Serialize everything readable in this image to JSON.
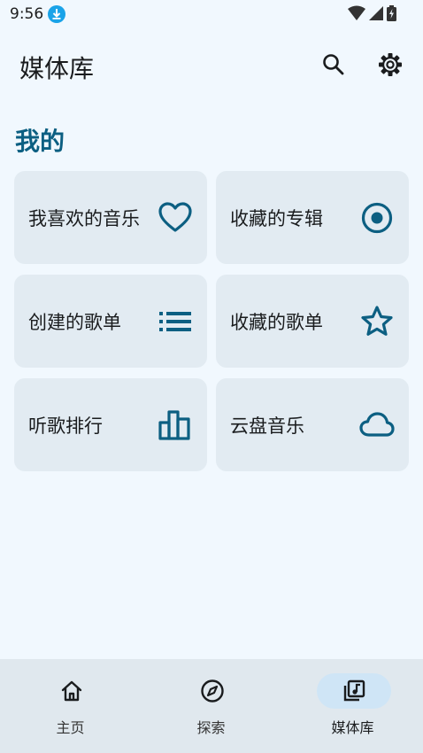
{
  "status_bar": {
    "time": "9:56"
  },
  "app_bar": {
    "title": "媒体库"
  },
  "section": {
    "title": "我的"
  },
  "cards": [
    {
      "label": "我喜欢的音乐",
      "icon": "heart-icon"
    },
    {
      "label": "收藏的专辑",
      "icon": "album-disc-icon"
    },
    {
      "label": "创建的歌单",
      "icon": "playlist-icon"
    },
    {
      "label": "收藏的歌单",
      "icon": "star-icon"
    },
    {
      "label": "听歌排行",
      "icon": "bar-chart-icon"
    },
    {
      "label": "云盘音乐",
      "icon": "cloud-icon"
    }
  ],
  "bottom_nav": {
    "items": [
      {
        "label": "主页",
        "icon": "home-icon",
        "active": false
      },
      {
        "label": "探索",
        "icon": "compass-icon",
        "active": false
      },
      {
        "label": "媒体库",
        "icon": "library-music-icon",
        "active": true
      }
    ]
  },
  "colors": {
    "accent": "#0c5f82",
    "background": "#f1f8fe",
    "card": "#e2ebf2",
    "nav_active_pill": "#cfe5f6"
  }
}
